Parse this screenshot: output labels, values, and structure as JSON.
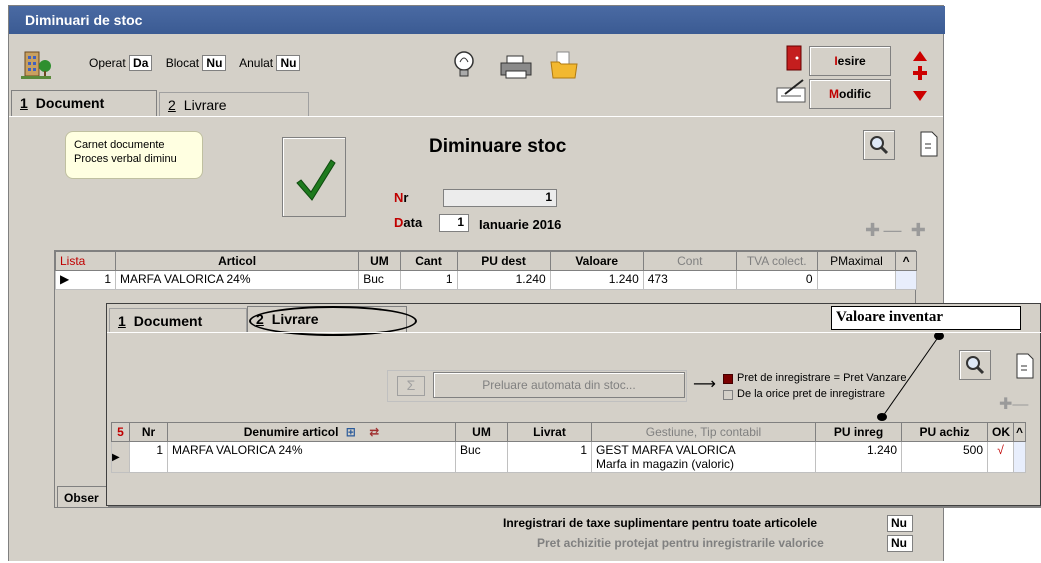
{
  "window": {
    "title": "Diminuari de stoc"
  },
  "toolbar": {
    "operat_label": "Operat",
    "operat_value": "Da",
    "blocat_label": "Blocat",
    "blocat_value": "Nu",
    "anulat_label": "Anulat",
    "anulat_value": "Nu",
    "exit_hot": "I",
    "exit_rest": "esire",
    "modify_hot": "M",
    "modify_rest": "odific"
  },
  "tabs": [
    {
      "num": "1",
      "label": "Document"
    },
    {
      "num": "2",
      "label": "Livrare"
    }
  ],
  "document": {
    "notes": [
      "Carnet documente",
      "Proces verbal diminu"
    ],
    "title": "Diminuare stoc",
    "nr_hot": "N",
    "nr_rest": "r",
    "nr_value": "1",
    "data_hot": "D",
    "data_rest": "ata",
    "day_value": "1",
    "date_text": "Ianuarie 2016"
  },
  "items_table": {
    "headers": [
      "Lista",
      "Articol",
      "UM",
      "Cant",
      "PU dest",
      "Valoare",
      "Cont",
      "TVA colect.",
      "PMaximal"
    ],
    "row": {
      "lista": "1",
      "articol": "MARFA VALORICA 24%",
      "um": "Buc",
      "cant": "1",
      "pu_dest": "1.240",
      "valoare": "1.240",
      "cont": "473",
      "tva": "0",
      "pmaximal": ""
    }
  },
  "overlay": {
    "tab1_num": "1",
    "tab1_label": "Document",
    "tab2_num": "2",
    "tab2_label": "Livrare",
    "callout": "Valoare inventar",
    "auto_button": "Preluare automata din stoc...",
    "option_checked": "Pret de inregistrare = Pret Vanzare",
    "option_unchecked": "De la orice pret de inregistrare",
    "table_headers": {
      "counter": "5",
      "nr": "Nr",
      "denumire": "Denumire articol",
      "um": "UM",
      "livrat": "Livrat",
      "gestiune": "Gestiune, Tip contabil",
      "pu_inreg": "PU inreg",
      "pu_achiz": "PU achiz",
      "ok": "OK"
    },
    "row": {
      "nr": "1",
      "denumire": "MARFA VALORICA 24%",
      "um": "Buc",
      "livrat": "1",
      "gestiune": "GEST MARFA VALORICA",
      "tip": "Marfa in magazin (valoric)",
      "pu_inreg": "1.240",
      "pu_achiz": "500",
      "ok": "√"
    }
  },
  "observatii_label": "Obser",
  "footer": {
    "line1": "Inregistrari de taxe suplimentare pentru toate articolele",
    "line1_value": "Nu",
    "line2": "Pret achizitie protejat pentru inregistrarile valorice",
    "line2_value": "Nu"
  },
  "colors": {
    "titlebar": "#3b5b93",
    "accent_red": "#cc0000",
    "notes_bg": "#ffffe1",
    "check_green": "#1e7a1e"
  }
}
